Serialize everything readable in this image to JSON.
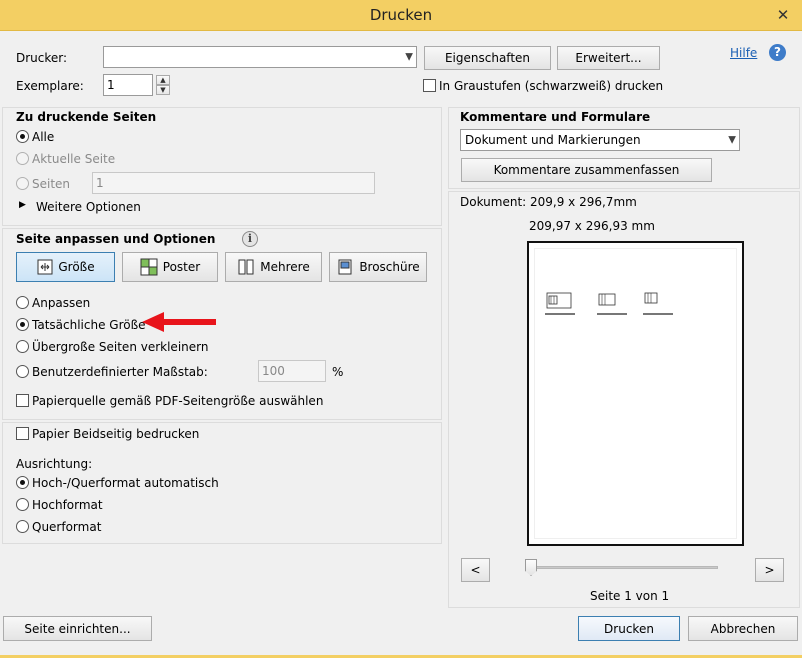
{
  "window": {
    "title": "Drucken",
    "close_glyph": "✕"
  },
  "printer": {
    "label": "Drucker:",
    "value": "",
    "properties_button": "Eigenschaften",
    "advanced_button": "Erweitert...",
    "help_link": "Hilfe",
    "copies_label": "Exemplare:",
    "copies_value": "1",
    "grayscale_label": "In Graustufen (schwarzweiß) drucken"
  },
  "pages_to_print": {
    "heading": "Zu druckende Seiten",
    "all": "Alle",
    "current": "Aktuelle Seite",
    "pages": "Seiten",
    "pages_value": "1",
    "more_options": "Weitere Optionen"
  },
  "sizing": {
    "heading": "Seite anpassen und Optionen",
    "buttons": [
      "Größe",
      "Poster",
      "Mehrere",
      "Broschüre"
    ],
    "fit": "Anpassen",
    "actual_size": "Tatsächliche Größe",
    "shrink": "Übergroße Seiten verkleinern",
    "custom_scale": "Benutzerdefinierter Maßstab:",
    "custom_scale_value": "100",
    "percent": "%",
    "paper_source": "Papierquelle gemäß PDF-Seitengröße auswählen"
  },
  "duplex": {
    "label": "Papier Beidseitig bedrucken"
  },
  "orientation": {
    "label": "Ausrichtung:",
    "auto": "Hoch-/Querformat automatisch",
    "portrait": "Hochformat",
    "landscape": "Querformat"
  },
  "comments": {
    "heading": "Kommentare und Formulare",
    "selected": "Dokument und Markierungen",
    "summarize_button": "Kommentare zusammenfassen"
  },
  "preview": {
    "document_size": "Dokument: 209,9 x 296,7mm",
    "paper_size": "209,97 x 296,93 mm",
    "prev": "<",
    "next": ">",
    "page_indicator": "Seite 1 von 1"
  },
  "footer": {
    "page_setup": "Seite einrichten...",
    "print": "Drucken",
    "cancel": "Abbrechen"
  },
  "colors": {
    "titlebar": "#f3cf63",
    "arrow": "#e8141b",
    "link": "#1a5fb4"
  }
}
